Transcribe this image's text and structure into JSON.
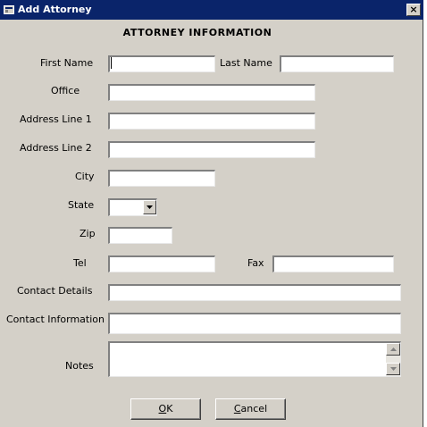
{
  "window": {
    "title": "Add Attorney",
    "close_glyph": "×",
    "icon": "app-window-icon"
  },
  "form": {
    "heading": "ATTORNEY INFORMATION",
    "labels": {
      "first_name": "First Name",
      "last_name": "Last Name",
      "office": "Office",
      "address1": "Address Line 1",
      "address2": "Address Line 2",
      "city": "City",
      "state": "State",
      "zip": "Zip",
      "tel": "Tel",
      "fax": "Fax",
      "contact_details": "Contact Details",
      "contact_information": "Contact Information",
      "notes": "Notes"
    },
    "values": {
      "first_name": "",
      "last_name": "",
      "office": "",
      "address1": "",
      "address2": "",
      "city": "",
      "state": "",
      "zip": "",
      "tel": "",
      "fax": "",
      "contact_details": "",
      "contact_information": "",
      "notes": ""
    }
  },
  "buttons": {
    "ok_mnemonic": "O",
    "ok_rest": "K",
    "cancel_mnemonic": "C",
    "cancel_rest": "ancel"
  },
  "colors": {
    "titlebar": "#0a246a",
    "dialog_bg": "#d4d0c8"
  }
}
